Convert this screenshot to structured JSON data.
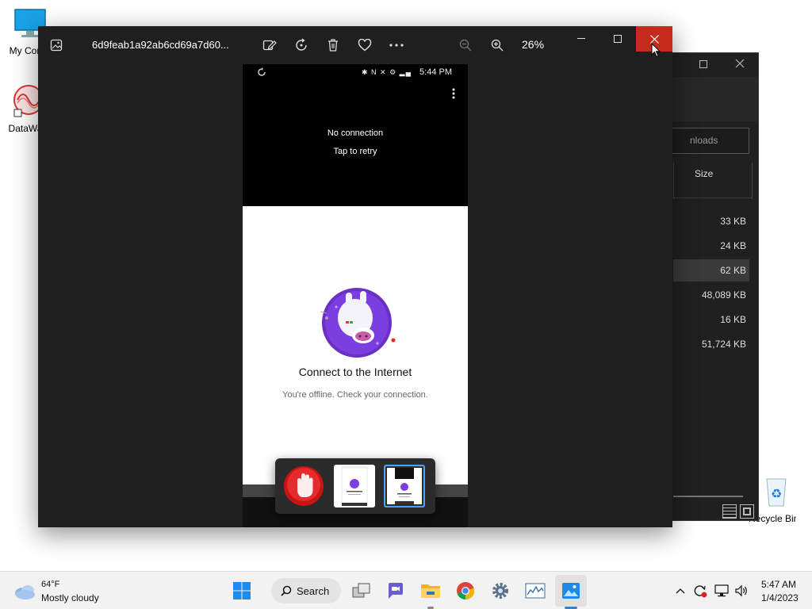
{
  "desktop": {
    "icons": [
      {
        "label": "My Com",
        "icon": "monitor-icon"
      },
      {
        "label": "DataWa",
        "icon": "datawave-icon"
      },
      {
        "label": "Recycle Bin",
        "icon": "recycle-bin-icon"
      }
    ]
  },
  "explorer": {
    "search_placeholder": "nloads",
    "column_size": "Size",
    "rows": [
      {
        "size": "33 KB",
        "selected": false
      },
      {
        "size": "24 KB",
        "selected": false
      },
      {
        "size": "62 KB",
        "selected": true
      },
      {
        "size": "48,089 KB",
        "selected": false
      },
      {
        "size": "16 KB",
        "selected": false
      },
      {
        "size": "51,724 KB",
        "selected": false
      }
    ]
  },
  "photos": {
    "filename": "6d9feab1a92ab6cd69a7d60...",
    "zoom": "26%",
    "close_color": "#c42b1c"
  },
  "phone": {
    "time": "5:44 PM",
    "no_connection": "No connection",
    "tap_retry": "Tap to retry",
    "heading": "Connect to the Internet",
    "subtext": "You're offline. Check your connection."
  },
  "taskbar": {
    "weather_temp": "64°F",
    "weather_desc": "Mostly cloudy",
    "search_label": "Search",
    "time": "5:47 AM",
    "date": "1/4/2023"
  }
}
